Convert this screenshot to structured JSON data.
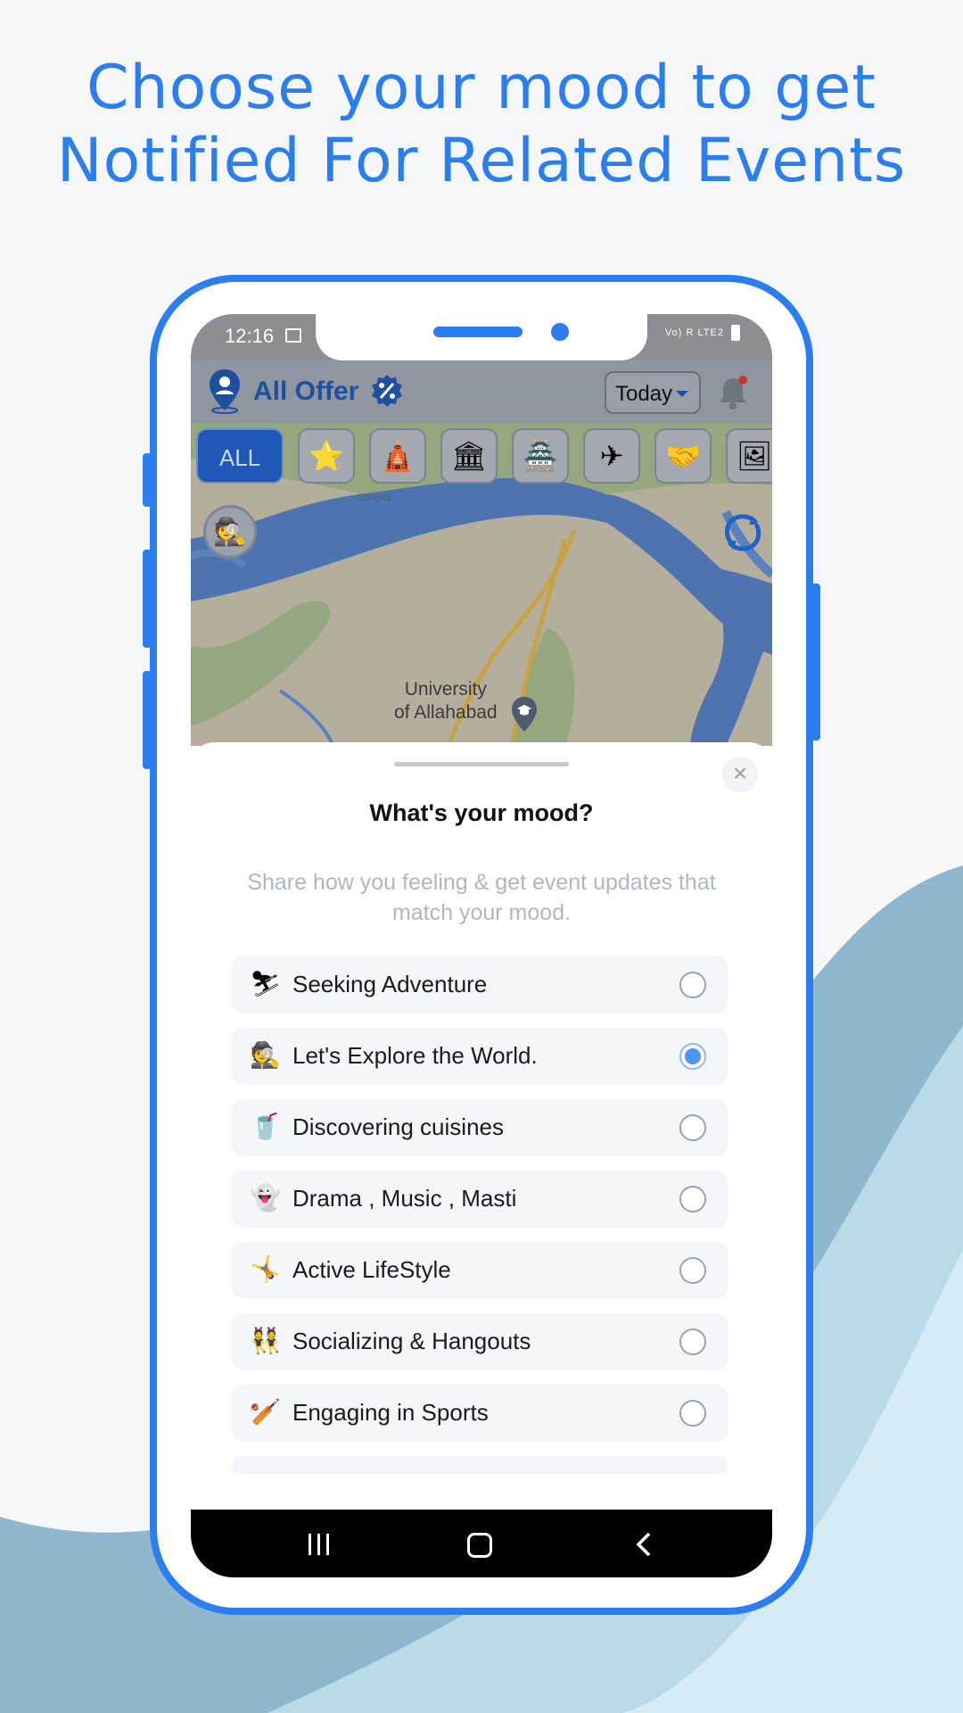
{
  "headline": {
    "line1": "Choose your mood to get",
    "line2": "Notified For Related Events"
  },
  "status_bar": {
    "time": "12:16",
    "right_indicators": "Vo) R LTE2"
  },
  "app_bar": {
    "brand": "All Offer",
    "date_filter": "Today"
  },
  "categories": {
    "all_label": "ALL",
    "icons": [
      "star-icon",
      "temple-icon",
      "museum-icon",
      "zoo-icon",
      "airplane-icon",
      "meeting-icon",
      "gallery-icon"
    ]
  },
  "map": {
    "label_ganges": "Ganges",
    "label_university_1": "University",
    "label_university_2": "of Allahabad"
  },
  "mood_sheet": {
    "title": "What's your mood?",
    "subtitle": "Share how you feeling & get event updates that match your mood.",
    "options": [
      {
        "emoji": "⛷",
        "label": "Seeking Adventure",
        "selected": false
      },
      {
        "emoji": "🕵",
        "label": "Let's Explore the World.",
        "selected": true
      },
      {
        "emoji": "🥤",
        "label": "Discovering cuisines",
        "selected": false
      },
      {
        "emoji": "👻",
        "label": "Drama , Music , Masti",
        "selected": false
      },
      {
        "emoji": "🤸",
        "label": "Active LifeStyle",
        "selected": false
      },
      {
        "emoji": "👯",
        "label": "Socializing & Hangouts",
        "selected": false
      },
      {
        "emoji": "🏏",
        "label": "Engaging in Sports",
        "selected": false
      }
    ]
  },
  "colors": {
    "accent": "#2a7ef0",
    "brand_dark": "#1e4fa0",
    "radio_selected": "#4f94f4"
  }
}
